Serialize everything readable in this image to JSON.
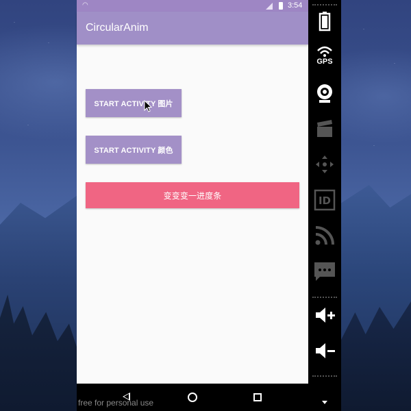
{
  "status_bar": {
    "time": "3:54"
  },
  "app": {
    "title": "CircularAnim",
    "primary_color": "#a08fc7",
    "accent_color": "#f06583"
  },
  "buttons": {
    "start_activity_image": "START ACTIVITY 图片",
    "start_activity_color": "START ACTIVITY 颜色",
    "progress_bar": "变变变一进度条"
  },
  "emulator_panel": {
    "gps_label": "GPS",
    "icons": [
      "battery-icon",
      "gps-icon",
      "camera-icon",
      "video-icon",
      "dpad-icon",
      "id-icon",
      "rss-icon",
      "sms-icon",
      "volume-up-icon",
      "volume-down-icon",
      "chevron-down-icon"
    ]
  },
  "navigation": {
    "icons": [
      "back-icon",
      "home-icon",
      "recent-apps-icon"
    ]
  },
  "watermark": "free for personal use"
}
